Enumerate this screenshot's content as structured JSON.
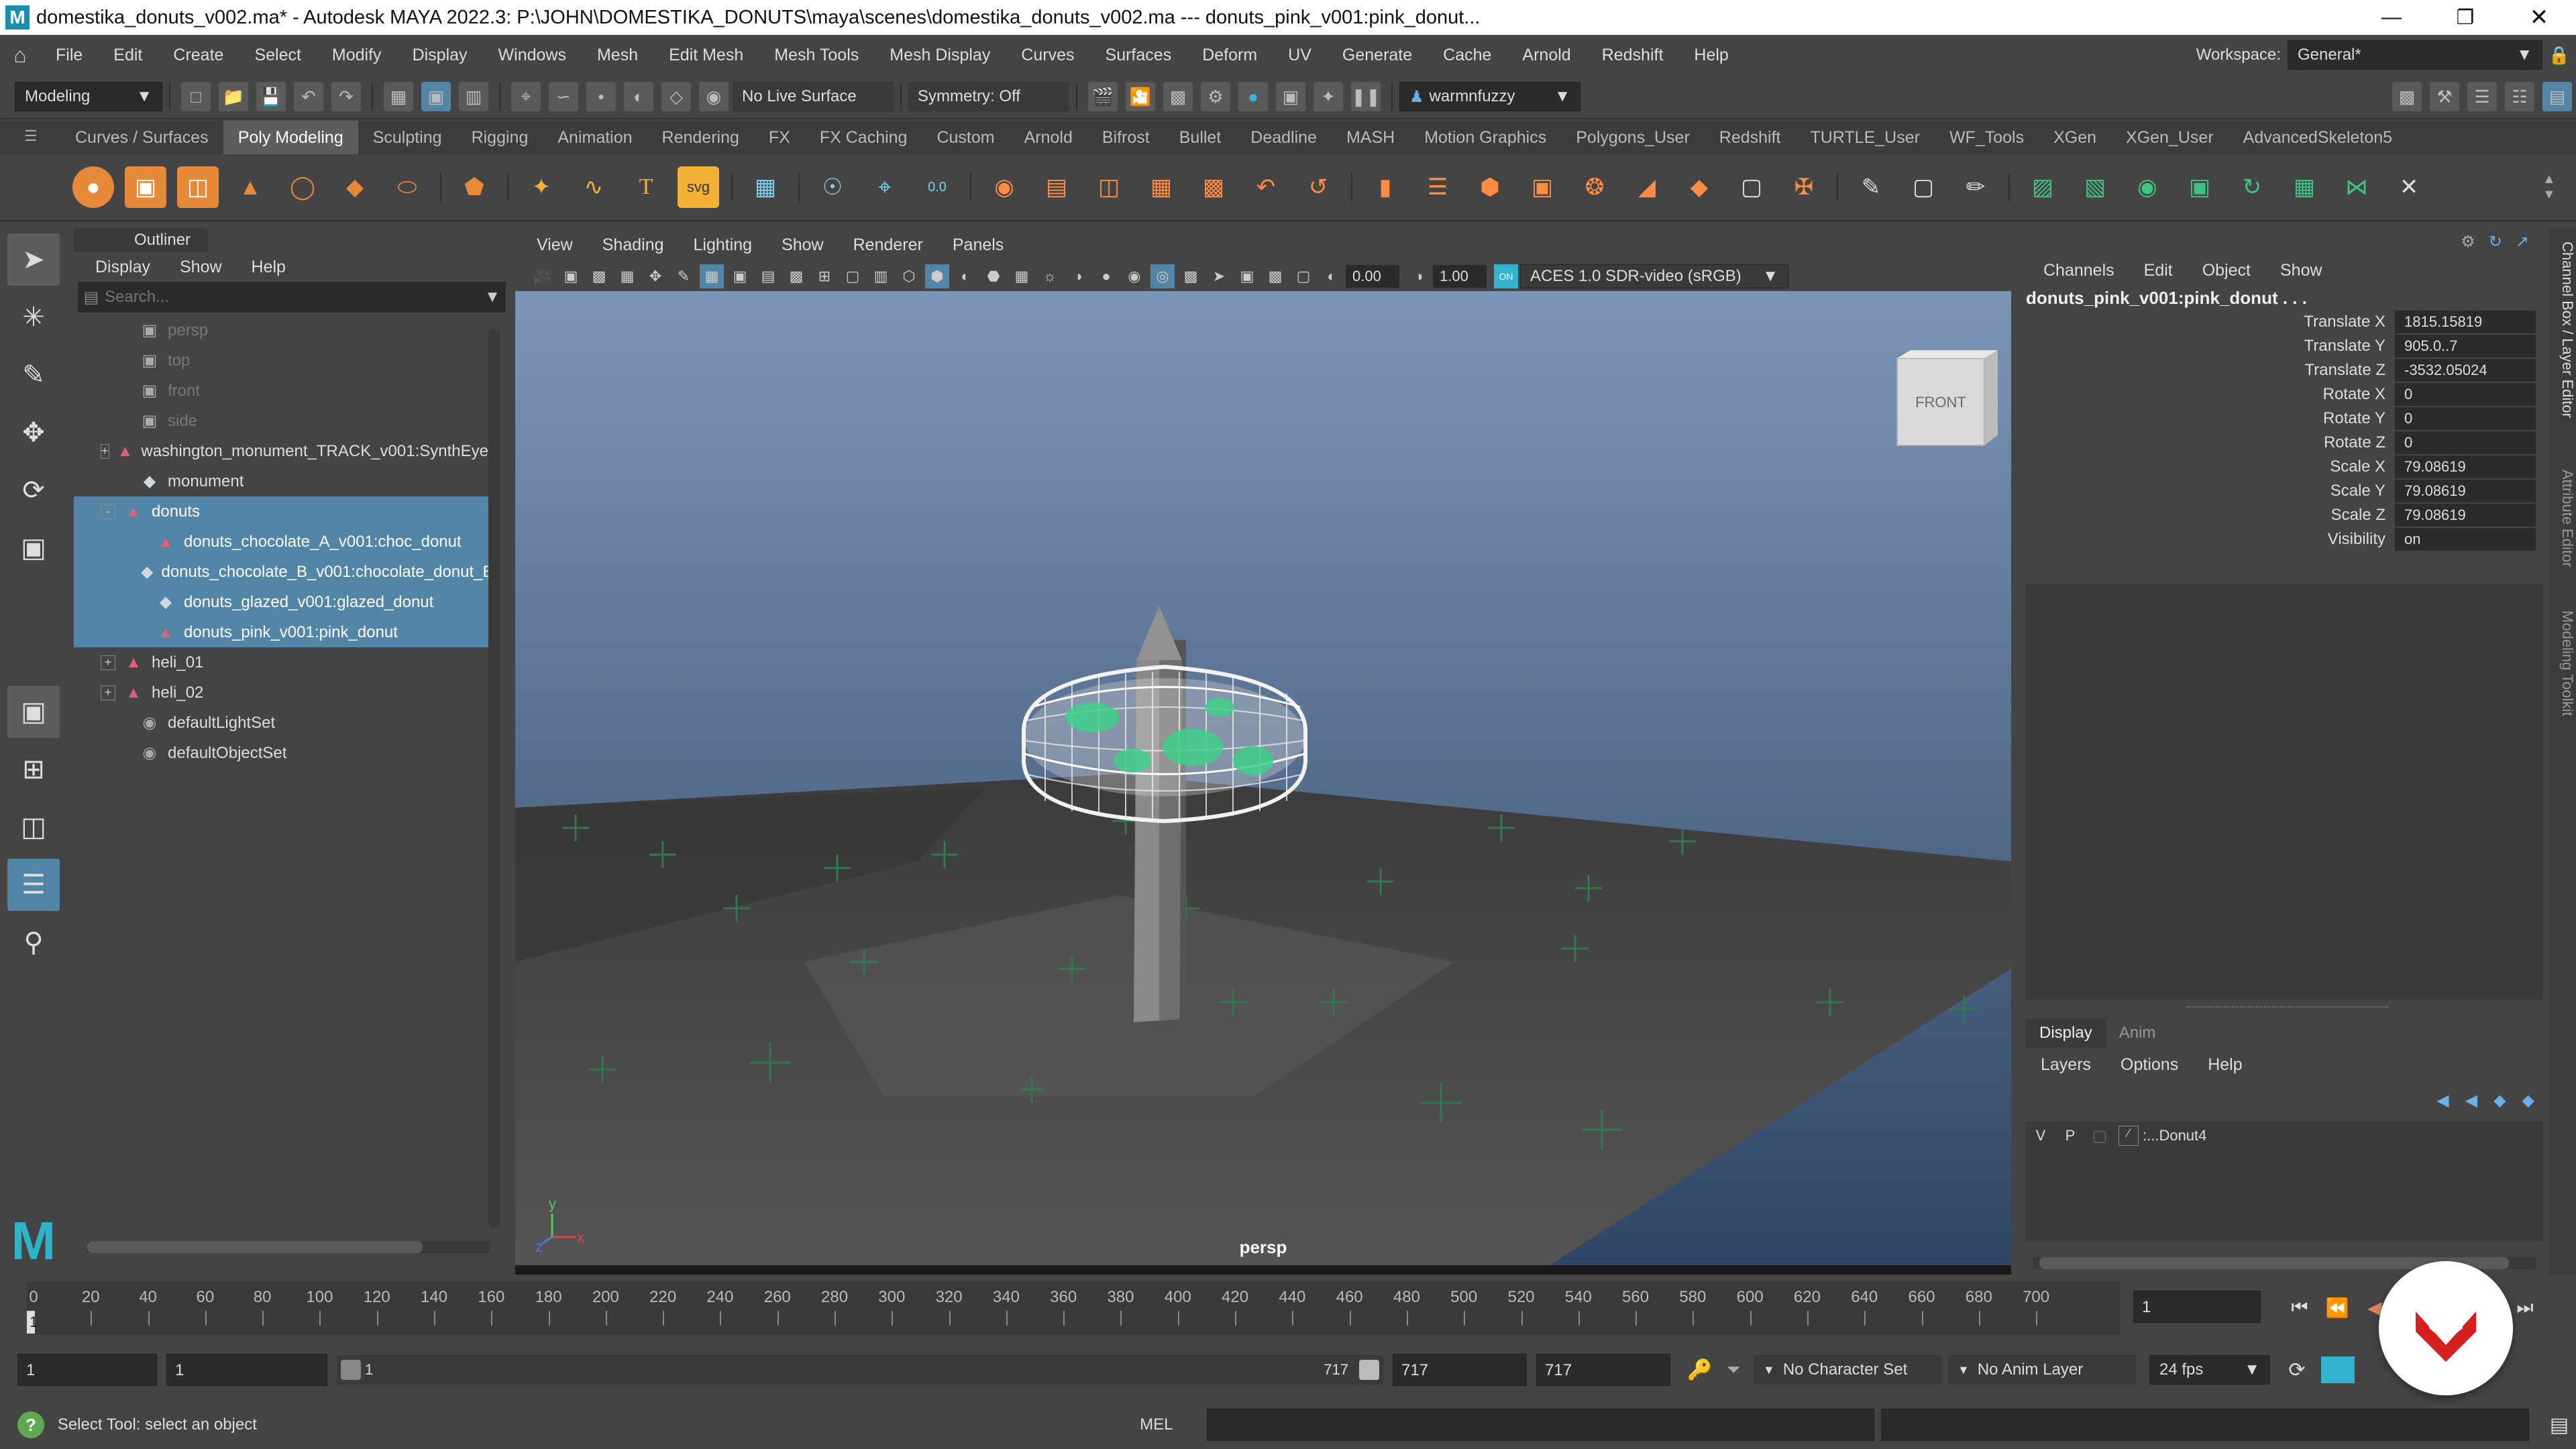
{
  "title_bar": {
    "text": "domestika_donuts_v002.ma* - Autodesk MAYA 2022.3: P:\\JOHN\\DOMESTIKA_DONUTS\\maya\\scenes\\domestika_donuts_v002.ma   ---   donuts_pink_v001:pink_donut..."
  },
  "menus": [
    "File",
    "Edit",
    "Create",
    "Select",
    "Modify",
    "Display",
    "Windows",
    "Mesh",
    "Edit Mesh",
    "Mesh Tools",
    "Mesh Display",
    "Curves",
    "Surfaces",
    "Deform",
    "UV",
    "Generate",
    "Cache",
    "Arnold",
    "Redshift",
    "Help"
  ],
  "workspace": {
    "label": "Workspace:",
    "value": "General*"
  },
  "status_line": {
    "mode": "Modeling",
    "live_surface": "No Live Surface",
    "symmetry": "Symmetry: Off",
    "user": "warmnfuzzy"
  },
  "shelf_tabs": [
    "Curves / Surfaces",
    "Poly Modeling",
    "Sculpting",
    "Rigging",
    "Animation",
    "Rendering",
    "FX",
    "FX Caching",
    "Custom",
    "Arnold",
    "Bifrost",
    "Bullet",
    "Deadline",
    "MASH",
    "Motion Graphics",
    "Polygons_User",
    "Redshift",
    "TURTLE_User",
    "WF_Tools",
    "XGen",
    "XGen_User",
    "AdvancedSkeleton5"
  ],
  "shelf_active_tab": "Poly Modeling",
  "shelf_text_icons": {
    "type": "T",
    "svg": "svg",
    "counter": "0.0"
  },
  "outliner": {
    "title": "Outliner",
    "menus": [
      "Display",
      "Show",
      "Help"
    ],
    "search_placeholder": "Search...",
    "items": [
      {
        "label": "persp",
        "indent": 1,
        "icon": "camera-icon",
        "dim": true,
        "expander": ""
      },
      {
        "label": "top",
        "indent": 1,
        "icon": "camera-icon",
        "dim": true,
        "expander": ""
      },
      {
        "label": "front",
        "indent": 1,
        "icon": "camera-icon",
        "dim": true,
        "expander": ""
      },
      {
        "label": "side",
        "indent": 1,
        "icon": "camera-icon",
        "dim": true,
        "expander": ""
      },
      {
        "label": "washington_monument_TRACK_v001:SynthEye",
        "indent": 0,
        "icon": "group-icon",
        "expander": "+"
      },
      {
        "label": "monument",
        "indent": 1,
        "icon": "mesh-icon",
        "expander": ""
      },
      {
        "label": "donuts",
        "indent": 0,
        "icon": "group-icon",
        "expander": "-",
        "selected": true
      },
      {
        "label": "donuts_chocolate_A_v001:choc_donut",
        "indent": 2,
        "icon": "group-icon",
        "selected": true,
        "expander": ""
      },
      {
        "label": "donuts_chocolate_B_v001:chocolate_donut_B",
        "indent": 2,
        "icon": "mesh-icon",
        "selected": true,
        "expander": ""
      },
      {
        "label": "donuts_glazed_v001:glazed_donut",
        "indent": 2,
        "icon": "mesh-icon",
        "selected": true,
        "expander": ""
      },
      {
        "label": "donuts_pink_v001:pink_donut",
        "indent": 2,
        "icon": "group-icon",
        "selected": true,
        "expander": ""
      },
      {
        "label": "heli_01",
        "indent": 0,
        "icon": "group-icon",
        "expander": "+"
      },
      {
        "label": "heli_02",
        "indent": 0,
        "icon": "group-icon",
        "expander": "+"
      },
      {
        "label": "defaultLightSet",
        "indent": 1,
        "icon": "set-icon",
        "expander": ""
      },
      {
        "label": "defaultObjectSet",
        "indent": 1,
        "icon": "set-icon",
        "expander": ""
      }
    ]
  },
  "viewport": {
    "menus": [
      "View",
      "Shading",
      "Lighting",
      "Show",
      "Renderer",
      "Panels"
    ],
    "exposure": "0.00",
    "gamma": "1.00",
    "color_space": "ACES 1.0 SDR-video (sRGB)",
    "camera_label": "persp",
    "view_cube": "FRONT",
    "axis_y": "y",
    "axis_z": "z",
    "axis_x": "x"
  },
  "channel_box": {
    "menus": [
      "Channels",
      "Edit",
      "Object",
      "Show"
    ],
    "object": "donuts_pink_v001:pink_donut . . .",
    "channels": [
      {
        "label": "Translate X",
        "value": "1815.15819"
      },
      {
        "label": "Translate Y",
        "value": "905.0..7"
      },
      {
        "label": "Translate Z",
        "value": "-3532.05024"
      },
      {
        "label": "Rotate X",
        "value": "0"
      },
      {
        "label": "Rotate Y",
        "value": "0"
      },
      {
        "label": "Rotate Z",
        "value": "0"
      },
      {
        "label": "Scale X",
        "value": "79.08619"
      },
      {
        "label": "Scale Y",
        "value": "79.08619"
      },
      {
        "label": "Scale Z",
        "value": "79.08619"
      },
      {
        "label": "Visibility",
        "value": "on"
      }
    ]
  },
  "layer_editor": {
    "tabs": [
      "Display",
      "Anim"
    ],
    "active_tab": "Display",
    "menus": [
      "Layers",
      "Options",
      "Help"
    ],
    "layer": {
      "v": "V",
      "p": "P",
      "name": ":...Donut4"
    }
  },
  "right_strip_tabs": [
    "Channel Box / Layer Editor",
    "Attribute Editor",
    "Modeling Toolkit"
  ],
  "timeline": {
    "ticks": [
      0,
      20,
      40,
      60,
      80,
      100,
      120,
      140,
      160,
      180,
      200,
      220,
      240,
      260,
      280,
      300,
      320,
      340,
      360,
      380,
      400,
      420,
      440,
      460,
      480,
      500,
      520,
      540,
      560,
      580,
      600,
      620,
      640,
      660,
      680,
      700
    ],
    "current_frame_marker": "1",
    "current_frame": "1"
  },
  "range": {
    "start": "1",
    "playback_start": "1",
    "slider_start": "1",
    "slider_end": "717",
    "playback_end": "717",
    "end": "717",
    "character_set": "No Character Set",
    "anim_layer": "No Anim Layer",
    "fps": "24 fps"
  },
  "command_line": {
    "help_text": "Select Tool: select an object",
    "mel_label": "MEL"
  },
  "colors": {
    "selection": "#5285a6",
    "accent": "#34b3d0",
    "maya_logo": "#2fb3c8",
    "watermark_red": "#d6201f"
  }
}
